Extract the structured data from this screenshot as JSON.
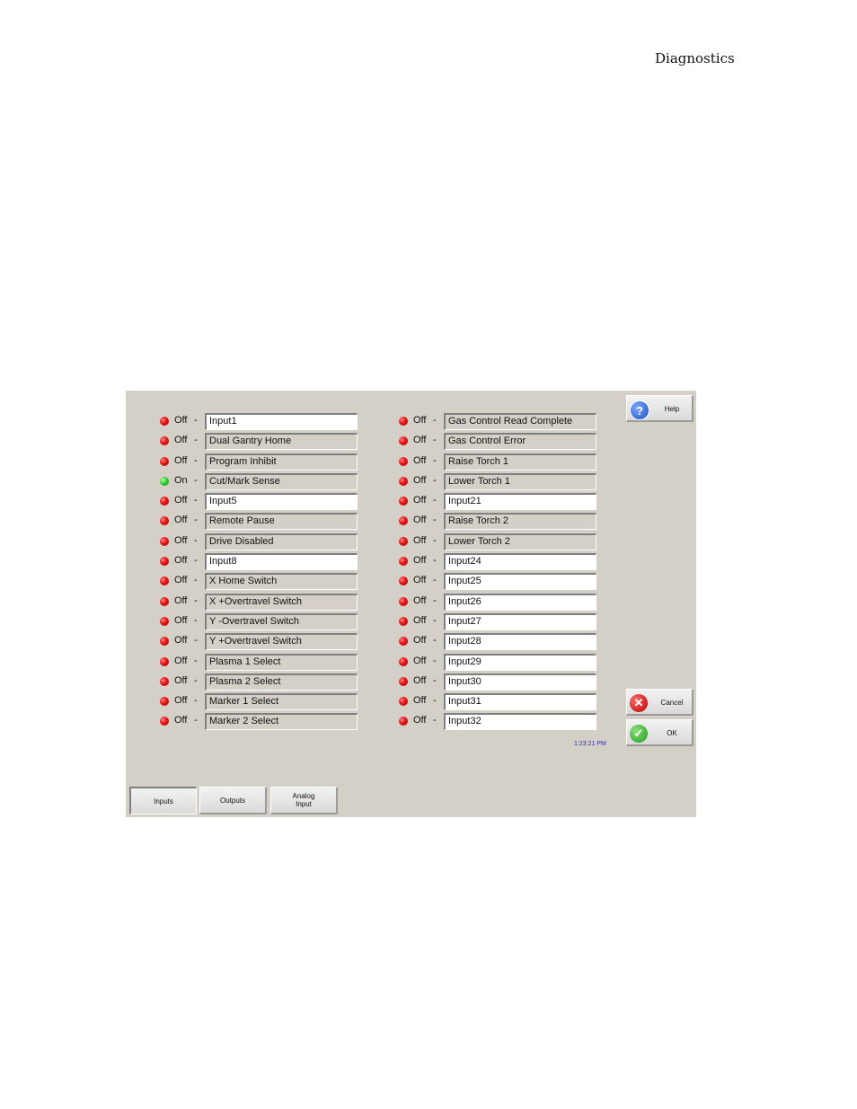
{
  "page_header": "Diagnostics",
  "inputs_left": [
    {
      "state": "Off",
      "label": "Input1",
      "editable": true
    },
    {
      "state": "Off",
      "label": "Dual Gantry Home",
      "editable": false
    },
    {
      "state": "Off",
      "label": "Program Inhibit",
      "editable": false
    },
    {
      "state": "On",
      "label": "Cut/Mark Sense",
      "editable": false
    },
    {
      "state": "Off",
      "label": "Input5",
      "editable": true
    },
    {
      "state": "Off",
      "label": "Remote Pause",
      "editable": false
    },
    {
      "state": "Off",
      "label": "Drive Disabled",
      "editable": false
    },
    {
      "state": "Off",
      "label": "Input8",
      "editable": true
    },
    {
      "state": "Off",
      "label": "X Home Switch",
      "editable": false
    },
    {
      "state": "Off",
      "label": "X +Overtravel Switch",
      "editable": false
    },
    {
      "state": "Off",
      "label": "Y -Overtravel Switch",
      "editable": false
    },
    {
      "state": "Off",
      "label": "Y +Overtravel Switch",
      "editable": false
    },
    {
      "state": "Off",
      "label": "Plasma 1 Select",
      "editable": false
    },
    {
      "state": "Off",
      "label": "Plasma 2 Select",
      "editable": false
    },
    {
      "state": "Off",
      "label": "Marker 1 Select",
      "editable": false
    },
    {
      "state": "Off",
      "label": "Marker 2 Select",
      "editable": false
    }
  ],
  "inputs_right": [
    {
      "state": "Off",
      "label": "Gas Control Read Complete",
      "editable": false
    },
    {
      "state": "Off",
      "label": "Gas Control Error",
      "editable": false
    },
    {
      "state": "Off",
      "label": "Raise Torch 1",
      "editable": false
    },
    {
      "state": "Off",
      "label": "Lower Torch 1",
      "editable": false
    },
    {
      "state": "Off",
      "label": "Input21",
      "editable": true
    },
    {
      "state": "Off",
      "label": "Raise Torch 2",
      "editable": false
    },
    {
      "state": "Off",
      "label": "Lower Torch 2",
      "editable": false
    },
    {
      "state": "Off",
      "label": "Input24",
      "editable": true
    },
    {
      "state": "Off",
      "label": "Input25",
      "editable": true
    },
    {
      "state": "Off",
      "label": "Input26",
      "editable": true
    },
    {
      "state": "Off",
      "label": "Input27",
      "editable": true
    },
    {
      "state": "Off",
      "label": "Input28",
      "editable": true
    },
    {
      "state": "Off",
      "label": "Input29",
      "editable": true
    },
    {
      "state": "Off",
      "label": "Input30",
      "editable": true
    },
    {
      "state": "Off",
      "label": "Input31",
      "editable": true
    },
    {
      "state": "Off",
      "label": "Input32",
      "editable": true
    }
  ],
  "separator": "-",
  "buttons": {
    "help": {
      "label": "Help",
      "icon": "question-icon"
    },
    "cancel": {
      "label": "Cancel",
      "icon": "x-icon"
    },
    "ok": {
      "label": "OK",
      "icon": "checkmark-icon"
    }
  },
  "clock": "1:23:21 PM",
  "tabs": [
    {
      "label": "Inputs",
      "active": true
    },
    {
      "label": "Outputs",
      "active": false
    },
    {
      "label": "Analog Input",
      "active": false
    }
  ],
  "colors": {
    "panel_bg": "#d4d0c8",
    "led_off": "#e81818",
    "led_on": "#35d035",
    "clock_text": "#2a2ad0"
  }
}
